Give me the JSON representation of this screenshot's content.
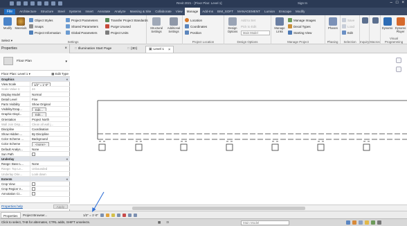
{
  "title": {
    "document": "Revit 2021 - [Floor Plan: Level 1]",
    "user": "Sign In"
  },
  "ribbon_tabs": [
    "Architecture",
    "Structure",
    "Steel",
    "Systems",
    "Insert",
    "Annotate",
    "Analyze",
    "Massing & Site",
    "Collaborate",
    "View",
    "Manage",
    "Add-Ins",
    "BIM_SOFT",
    "MANAGEMENT",
    "Lumion",
    "Enscape",
    "Modify"
  ],
  "file_tab": "File",
  "active_tab": "Manage",
  "ribbon": {
    "settings": {
      "group": "Settings",
      "modify": "Modify",
      "materials": "Materials",
      "object_styles": "Object Styles",
      "snaps": "Snaps",
      "project_information": "Project Information",
      "project_parameters": "Project Parameters",
      "shared_parameters": "Shared Parameters",
      "global_parameters": "Global Parameters",
      "transfer_standards": "Transfer Project Standards",
      "purge_unused": "Purge Unused",
      "project_units": "Project Units",
      "structural_settings": "Structural Settings",
      "additional_settings": "Additional Settings"
    },
    "project_location": {
      "group": "Project Location",
      "location": "Location",
      "coordinates": "Coordinates",
      "position": "Position"
    },
    "design_options": {
      "group": "Design Options",
      "design_options": "Design Options",
      "add_to_set": "Add to Set",
      "pick_to_edit": "Pick to Edit",
      "main_model": "Main Model"
    },
    "manage_project": {
      "group": "Manage Project",
      "manage_links": "Manage Links",
      "manage_images": "Manage Images",
      "decal_types": "Decal Types",
      "starting_view": "Starting View"
    },
    "phasing": {
      "group": "Phasing",
      "phases": "Phases"
    },
    "selection": {
      "group": "Selection",
      "save": "Save",
      "load": "Load",
      "edit": "Edit"
    },
    "inquiry": {
      "group": "Inquiry"
    },
    "macros": {
      "group": "Macros"
    },
    "visual_programming": {
      "group": "Visual Programming",
      "dynamo": "Dynamo",
      "dynamo_player": "Dynamo Player"
    }
  },
  "select_label": "Select",
  "properties_panel": {
    "title": "Properties",
    "type_name": "Floor Plan",
    "instance": "Floor Plan: Level 1",
    "edit_type": "Edit Type",
    "rows": [
      {
        "k": "Graphics",
        "v": "",
        "type": "hdr"
      },
      {
        "k": "View Scale",
        "v": "1/2\" = 1'-0\"",
        "type": "dd"
      },
      {
        "k": "Scale Value    1:",
        "v": "24",
        "type": "gray"
      },
      {
        "k": "Display Model",
        "v": "Normal",
        "type": ""
      },
      {
        "k": "Detail Level",
        "v": "Fine",
        "type": ""
      },
      {
        "k": "Parts Visibility",
        "v": "Show Original",
        "type": ""
      },
      {
        "k": "Visibility/Grap...",
        "v": "Edit...",
        "type": "box"
      },
      {
        "k": "Graphic Displ...",
        "v": "Edit...",
        "type": "box"
      },
      {
        "k": "Orientation",
        "v": "Project North",
        "type": ""
      },
      {
        "k": "Wall Join Disp...",
        "v": "Clean all wall j...",
        "type": "gray"
      },
      {
        "k": "Discipline",
        "v": "Coordination",
        "type": ""
      },
      {
        "k": "Show Hidden ...",
        "v": "By Discipline",
        "type": ""
      },
      {
        "k": "Color Scheme ...",
        "v": "Background",
        "type": ""
      },
      {
        "k": "Color Scheme",
        "v": "<none>",
        "type": "box"
      },
      {
        "k": "Default Analys...",
        "v": "None",
        "type": ""
      },
      {
        "k": "Sun Path",
        "v": "",
        "type": "chk"
      },
      {
        "k": "Underlay",
        "v": "",
        "type": "hdr"
      },
      {
        "k": "Range: Base L...",
        "v": "None",
        "type": ""
      },
      {
        "k": "Range: Top Le...",
        "v": "Unbounded",
        "type": "gray"
      },
      {
        "k": "Underlay Orie...",
        "v": "Look down",
        "type": "gray"
      },
      {
        "k": "Extents",
        "v": "",
        "type": "hdr"
      },
      {
        "k": "Crop View",
        "v": "",
        "type": "chk"
      },
      {
        "k": "Crop Region V...",
        "v": "",
        "type": "chk"
      },
      {
        "k": "Annotation Cr...",
        "v": "",
        "type": "chk"
      }
    ],
    "help": "Properties help",
    "apply": "Apply"
  },
  "view_tabs": [
    {
      "label": "Illumination Start Page",
      "active": false
    },
    {
      "label": "{3D}",
      "active": false
    },
    {
      "label": "Level 1",
      "active": true
    }
  ],
  "bottom_tabs": {
    "properties": "Properties",
    "browser": "Project Browser..."
  },
  "view_scale": "1/2\" = 1'-0\"",
  "status": {
    "message": "Click to select, TAB for alternates, CTRL adds, SHIFT unselects.",
    "model": "Main Model",
    "zero": ":0"
  },
  "colors": {
    "accent": "#1f6fc4",
    "ribbon_dark": "#3a4a66"
  }
}
